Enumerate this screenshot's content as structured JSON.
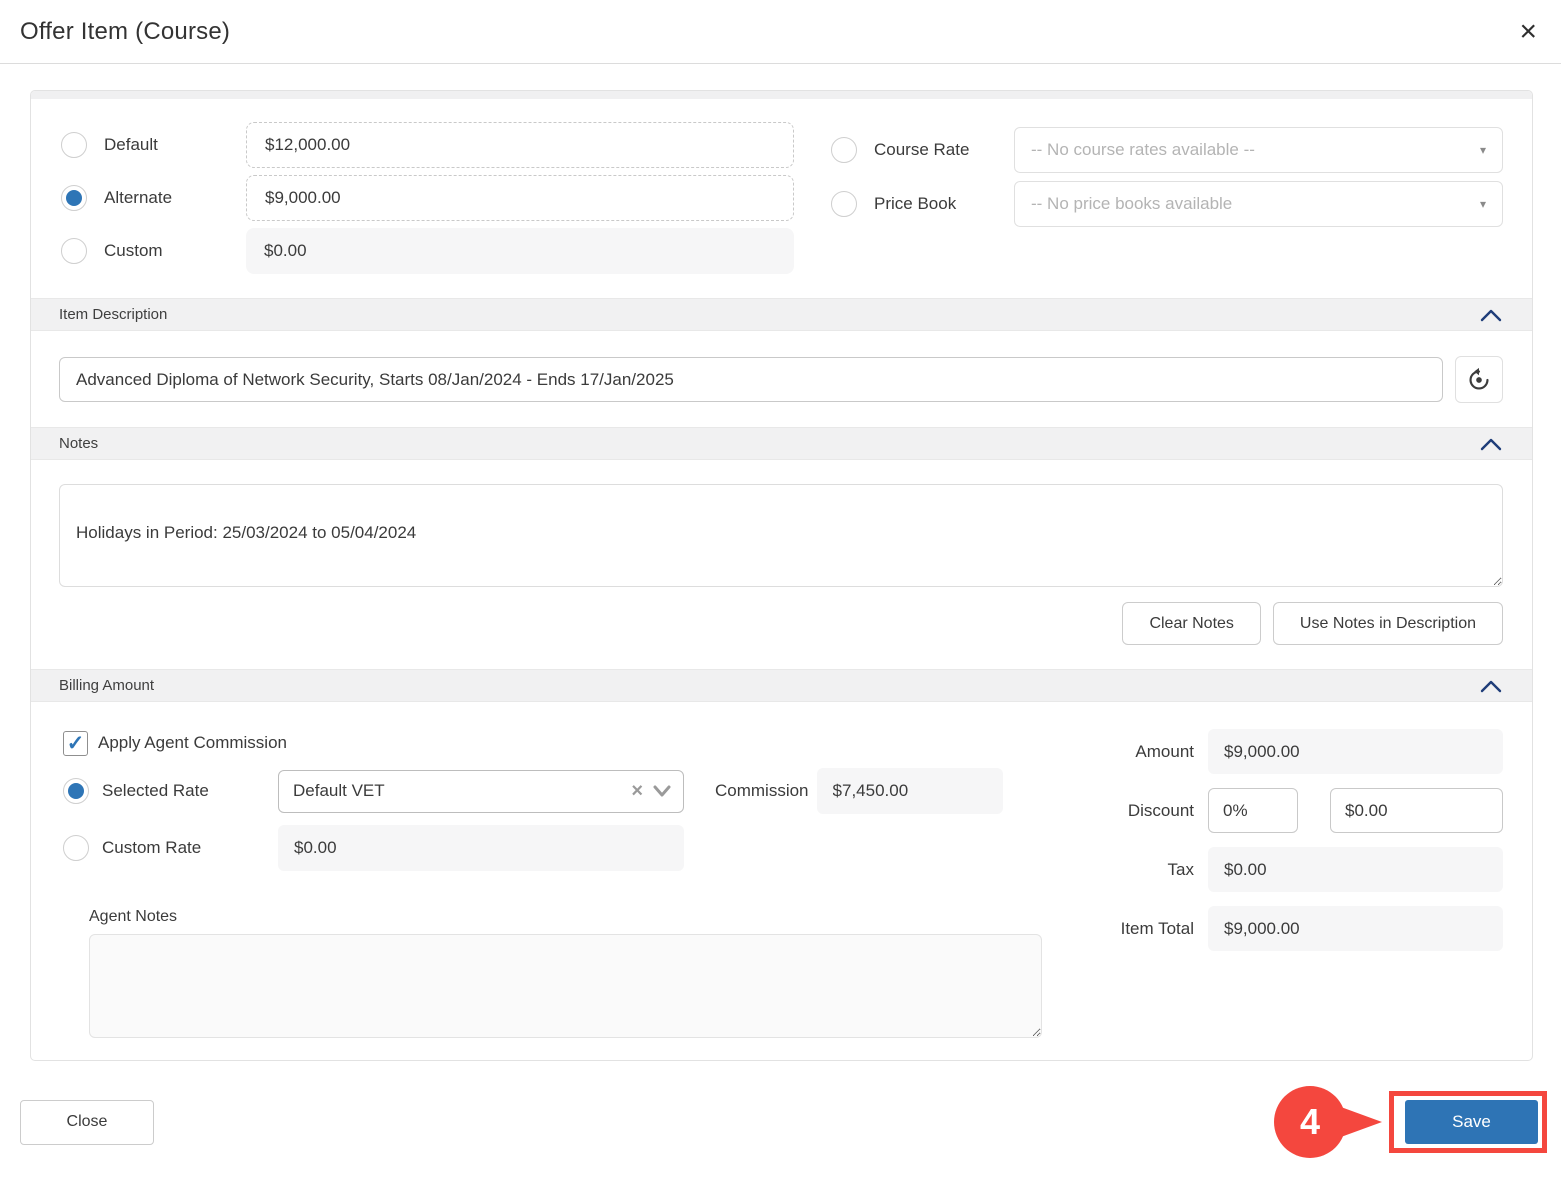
{
  "modal": {
    "title": "Offer Item (Course)",
    "close_glyph": "×"
  },
  "rates": {
    "options": [
      {
        "label": "Default",
        "value": "$12,000.00",
        "selected": false
      },
      {
        "label": "Alternate",
        "value": "$9,000.00",
        "selected": true
      },
      {
        "label": "Custom",
        "value": "$0.00",
        "selected": false
      }
    ],
    "course_rate": {
      "label": "Course Rate",
      "placeholder": "-- No course rates available --"
    },
    "price_book": {
      "label": "Price Book",
      "placeholder": "-- No price books available"
    },
    "caret_glyph": "▾"
  },
  "item_description": {
    "header": "Item Description",
    "value": "Advanced Diploma of Network Security, Starts 08/Jan/2024 - Ends 17/Jan/2025"
  },
  "notes": {
    "header": "Notes",
    "value": "Holidays in Period: 25/03/2024 to 05/04/2024",
    "clear_button": "Clear Notes",
    "use_button": "Use Notes in Description"
  },
  "billing": {
    "header": "Billing Amount",
    "apply_agent_commission": {
      "label": "Apply Agent Commission",
      "checked": true,
      "check_glyph": "✓"
    },
    "selected_rate": {
      "label": "Selected Rate",
      "value": "Default VET",
      "clear_glyph": "×"
    },
    "custom_rate": {
      "label": "Custom Rate",
      "value": "$0.00"
    },
    "commission": {
      "label": "Commission",
      "value": "$7,450.00"
    },
    "amount": {
      "label": "Amount",
      "value": "$9,000.00"
    },
    "discount": {
      "label": "Discount",
      "percent": "0%",
      "value": "$0.00"
    },
    "tax": {
      "label": "Tax",
      "value": "$0.00"
    },
    "item_total": {
      "label": "Item Total",
      "value": "$9,000.00"
    },
    "agent_notes": {
      "label": "Agent Notes",
      "value": ""
    }
  },
  "footer": {
    "close_button": "Close",
    "save_button": "Save",
    "annotation_step": "4"
  },
  "colors": {
    "accent_blue": "#2e74b5",
    "chevron_navy": "#1f3d79",
    "annotation_red": "#f4473e",
    "section_bar_bg": "#f1f1f2"
  }
}
